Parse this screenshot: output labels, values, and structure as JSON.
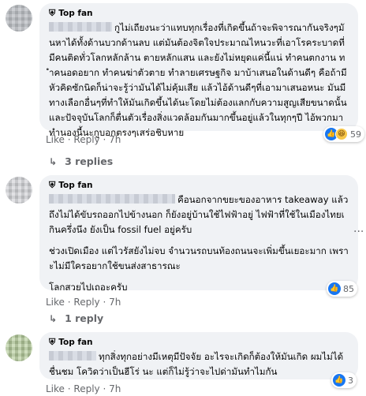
{
  "comments": [
    {
      "badge": "Top fan",
      "paragraphs": [
        "กูไม่เถียงนะว่าแทบทุกเรื่องที่เกิดขึ้นถ้าจะพิจารณากันจริงๆมันหาได้ทั้งด้านบวกด้านลบ แต่มันต้องจิตใจประมาณไหนวะที่เอาโรคระบาดที่มีคนติดทั่วโลกหลักล้าน ตายหลักแสน และยังไม่หยุดแค่นี้แน่ ทำคนตกงาน ทำคนอดอยาก ทำคนฆ่าตัวตาย ทำลายเศรษฐกิจ มาบ้าเสนอในด้านดีๆ คือถ้ามีหัวคิดซักนิดก็น่าจะรู้ว่ามันได้ไม่คุ้มเสีย แล้วไอ้ด้านดีๆที่เอามาเสนอหนะ มันมีทางเลือกอื่นๆที่ทำให้มันเกิดขึ้นได้นะโดยไม่ต้องแลกกับความสูญเสียขนาดนั้น และปัจจุบันโลกก็ตื่นตัวเรื่องสิ่งแวดล้อมกันมากขึ้นอยู่แล้วในทุกๆปี ไอ้พวกมาทำนองนี้นะกูบอกตรงๆเสร่อชิบหาย"
      ],
      "actions": {
        "like": "Like",
        "reply": "Reply",
        "time": "7h"
      },
      "reaction_count": "59",
      "replies_label": "3 replies"
    },
    {
      "badge": "Top fan",
      "paragraphs": [
        "คือนอกจากขยะของอาหาร takeaway แล้ว ถึงไม่ได้ขับรถออกไปข้างนอก ก็ยังอยู่บ้านใช้ไฟฟ้าอยู่ ไฟฟ้าที่ใช้ในเมืองไทยเกินครึ่งนึง ยังเป็น fossil fuel อยู่ครับ",
        "ช่วงเปิดเมือง แต่ไวรัสยังไม่จบ จำนวนรถบนท้องถนนจะเพิ่มขึ้นเยอะมาก เพราะไม่มีใครอยากใช้ขนส่งสาธารณะ",
        "โลกสวยไปเถอะครับ"
      ],
      "actions": {
        "like": "Like",
        "reply": "Reply",
        "time": "7h"
      },
      "reaction_count": "85",
      "replies_label": "1 reply"
    },
    {
      "badge": "Top fan",
      "paragraphs": [
        "ทุกสิ่งทุกอย่างมีเหตุมีปัจจัย อะไรจะเกิดก็ต้องให้มันเกิด ผมไม่ได้ชื่นชม โควิดว่าเป็นฮีโร่ นะ แต่ก็ไม่รู้ว่าจะไปด่ามันทำไมกัน"
      ],
      "actions": {
        "like": "Like",
        "reply": "Reply",
        "time": "7h"
      },
      "reaction_count": "3"
    }
  ],
  "colors": {
    "accent": "#1877f2",
    "bubble": "#f0f2f5",
    "meta": "#65676b"
  },
  "icons": {
    "badge": "shield-icon",
    "like": "thumbs-up-icon",
    "haha": "laughing-face-icon",
    "more": "more-dots-icon",
    "reply": "reply-arrow-icon"
  }
}
